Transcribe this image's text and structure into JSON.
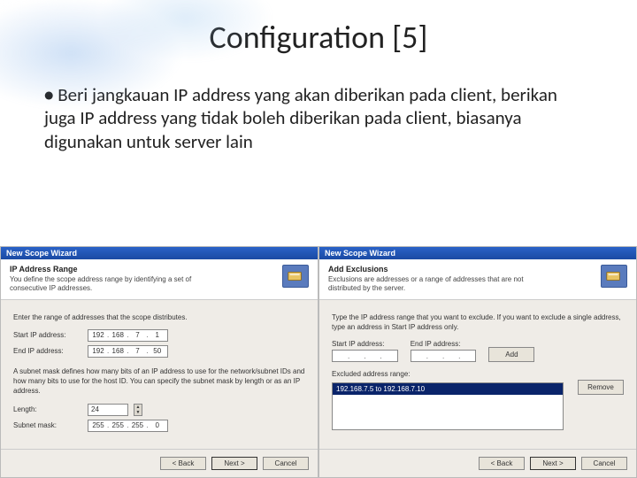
{
  "slide": {
    "title": "Configuration [5]",
    "bullet": "Beri jangkauan IP address yang akan diberikan pada client, berikan juga IP address yang tidak boleh diberikan pada client, biasanya digunakan untuk server lain"
  },
  "dlg_left": {
    "titlebar": "New Scope Wizard",
    "header_title": "IP Address Range",
    "header_sub": "You define the scope address range by identifying a set of consecutive IP addresses.",
    "para1": "Enter the range of addresses that the scope distributes.",
    "start_label": "Start IP address:",
    "start_ip": [
      "192",
      "168",
      "7",
      "1"
    ],
    "end_label": "End IP address:",
    "end_ip": [
      "192",
      "168",
      "7",
      "50"
    ],
    "para2": "A subnet mask defines how many bits of an IP address to use for the network/subnet IDs and how many bits to use for the host ID. You can specify the subnet mask by length or as an IP address.",
    "length_label": "Length:",
    "length_val": "24",
    "mask_label": "Subnet mask:",
    "mask_ip": [
      "255",
      "255",
      "255",
      "0"
    ],
    "back": "< Back",
    "next": "Next >",
    "cancel": "Cancel"
  },
  "dlg_right": {
    "titlebar": "New Scope Wizard",
    "header_title": "Add Exclusions",
    "header_sub": "Exclusions are addresses or a range of addresses that are not distributed by the server.",
    "para1": "Type the IP address range that you want to exclude. If you want to exclude a single address, type an address in Start IP address only.",
    "start_label": "Start IP address:",
    "end_label": "End IP address:",
    "add": "Add",
    "excl_label": "Excluded address range:",
    "excl_item": "192.168.7.5 to 192.168.7.10",
    "remove": "Remove",
    "back": "< Back",
    "next": "Next >",
    "cancel": "Cancel"
  }
}
